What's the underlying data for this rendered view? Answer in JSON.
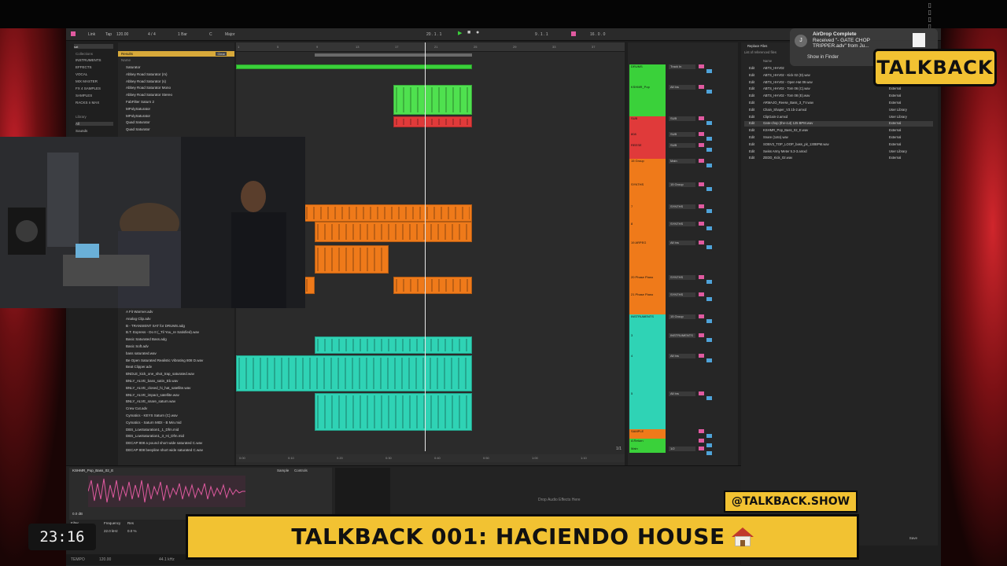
{
  "topbar": {
    "icons": [
      "wifi-icon",
      "battery-icon",
      "clock-icon"
    ]
  },
  "transport": {
    "link": "Link",
    "tap": "Tap",
    "tempo": "120.00",
    "signature": "4 / 4",
    "quantize": "1 Bar",
    "key": "C",
    "scale": "Major",
    "position": "20 . 1 . 1",
    "loop_start": "9 . 1 . 1",
    "loop_length": "16 . 0 . 0"
  },
  "browser": {
    "search_value": "sat",
    "collections_label": "Collections",
    "collections": [
      "INSTRUMENTS",
      "EFFECTS",
      "VOCAL",
      "MIX MASTER",
      "FX 4 SAMPLES",
      "SAMPLES",
      "RACKS n MAX"
    ],
    "library_label": "Library",
    "library": [
      "All",
      "Sounds"
    ],
    "results_label": "Results",
    "clear_label": "Clear",
    "name_header": "Name",
    "results_top": [
      "Saturator",
      "Abbey Road Saturator (m)",
      "Abbey Road Saturator (s)",
      "Abbey Road Saturator Mono",
      "Abbey Road Saturator Stereo",
      "FabFilter Saturn 2",
      "MPolySaturator",
      "MPolySaturator",
      "Quad Saturator",
      "Quad Saturator"
    ],
    "results_bottom": [
      "A Fit Warmer.adv",
      "Analog Clip.adv",
      "B - TRANSIENT SAT for DRUMS.adg",
      "B.T. Express - Do It (_Til You_re Satisfied).wav",
      "Basic Saturated Bass.adg",
      "Basic Soft.adv",
      "bass saturated.wav",
      "Be Open Saturated Realistic Vibrating 808 D.wav",
      "Beat Clipper.adv",
      "BNDLE_kick_one_shot_trap_saturated.wav",
      "BNLY_ALVE_bass_satin_Eb.wav",
      "BNLY_ALVE_closed_hi_hat_satellite.wav",
      "BNLY_ALVE_impact_satellite.wav",
      "BNLY_ALVE_snare_saturn.wav",
      "Crew Cut.adv",
      "Cymatics - KEYS Saturn (C).wav",
      "Cymatics - Saturn MIDI - B Min.mid",
      "DBS_LowSaturation1_1_Dfm.mid",
      "DBS_LowSaturation1_3_Hi_Dfm.mid",
      "DECAP 808 a pound short wide saturated C.wav",
      "DECAP 808 beepline short wide saturated C.wav"
    ]
  },
  "arrangement": {
    "ruler": [
      "1",
      "5",
      "9",
      "13",
      "17",
      "21",
      "25",
      "29",
      "33",
      "37"
    ],
    "time": [
      "0:00",
      "0:10",
      "0:20",
      "0:30",
      "0:40",
      "0:50",
      "1:00",
      "1:10"
    ],
    "page_indicator": "1/1"
  },
  "tracks": [
    {
      "name": "DRUMS",
      "color": "#3ad13a",
      "io": "Track In"
    },
    {
      "name": "KSHMR_Pop",
      "color": "#3ad13a",
      "io": "All Ins"
    },
    {
      "name": "SUB",
      "color": "#e03a3a",
      "io": "SUB"
    },
    {
      "name": "808",
      "color": "#e03a3a",
      "io": "SUB"
    },
    {
      "name": "REESE",
      "color": "#e03a3a",
      "io": "SUB"
    },
    {
      "name": "15 Group",
      "color": "#ef7a1a",
      "io": "Main"
    },
    {
      "name": "SYNTHS",
      "color": "#ef7a1a",
      "io": "15 Group"
    },
    {
      "name": "7",
      "color": "#ef7a1a",
      "io": "SYNTHS"
    },
    {
      "name": "8",
      "color": "#ef7a1a",
      "io": "SYNTHS"
    },
    {
      "name": "19 ARPEG",
      "color": "#ef7a1a",
      "io": "All Ins"
    },
    {
      "name": "20 Phase Piano",
      "color": "#ef7a1a",
      "io": "SYNTHS"
    },
    {
      "name": "21 Phase Piano",
      "color": "#ef7a1a",
      "io": "SYNTHS"
    },
    {
      "name": "INSTRUMENTS",
      "color": "#2fd3b5",
      "io": "15 Group"
    },
    {
      "name": "3",
      "color": "#2fd3b5",
      "io": "INSTRUMENTS"
    },
    {
      "name": "4",
      "color": "#2fd3b5",
      "io": "All Ins"
    },
    {
      "name": "5",
      "color": "#2fd3b5",
      "io": "All Ins"
    },
    {
      "name": "SAMPLE",
      "color": "#ef7a1a",
      "io": ""
    },
    {
      "name": "A Return",
      "color": "#3ad13a",
      "io": ""
    },
    {
      "name": "Main",
      "color": "#3ad13a",
      "io": "1/2"
    }
  ],
  "filelist": {
    "title": "Replace Files",
    "subtitle": "List of referenced files",
    "name_header": "Name",
    "edit_label": "Edit",
    "rows": [
      {
        "name": "ABTS_HHV02",
        "loc": "External"
      },
      {
        "name": "ABTS_HHV02 - Kick 02 (D).wav",
        "loc": "External"
      },
      {
        "name": "ABTS_HHV02 - Open Hat 09.wav",
        "loc": "External"
      },
      {
        "name": "ABTS_HHV02 - Tom 06 (C).wav",
        "loc": "External"
      },
      {
        "name": "ABTS_HHV02 - Tom 08 (E).wav",
        "loc": "External"
      },
      {
        "name": "ARMAJO_Reese_Bass_3_TV.wav",
        "loc": "External"
      },
      {
        "name": "Chain_Shaper_V3.1b-2.amxd",
        "loc": "User Library"
      },
      {
        "name": "ClipGain-2.amxd",
        "loc": "User Library"
      },
      {
        "name": "Gate-chop (the-cut) 125 BPM.wav",
        "loc": "External"
      },
      {
        "name": "KSHMR_Pop_Bass_02_E.wav",
        "loc": "External"
      },
      {
        "name": "Snare (1oto).wav",
        "loc": "External"
      },
      {
        "name": "SOBV3_TOP_LOOP_bass_pit_130BPM.wav",
        "loc": "External"
      },
      {
        "name": "Swiss Army Meter 5.3-3.amxd",
        "loc": "User Library"
      },
      {
        "name": "ZEDD_Kick_02.wav",
        "loc": "External"
      }
    ],
    "save_label": "Save"
  },
  "detail": {
    "clip_name": "KSHMR_Pop_Bass_02_E",
    "sample_tab": "Sample",
    "controls_tab": "Controls",
    "gain": "0.0 dB",
    "filter_label": "Filter",
    "frequency_label": "Frequency",
    "res_label": "Res",
    "freq_value": "22.0 kHz",
    "res_value": "0.0 %",
    "drop_text": "Drop Audio Effects Here",
    "status_tempo": "120.00",
    "status_rate": "44.1 kHz",
    "status_label": "TEMPO"
  },
  "airdrop": {
    "title": "AirDrop Complete",
    "message": "Received \"- GATE CHOP TRIPPER.adv\" from Ju...",
    "action": "Show in Finder",
    "icon": "airdrop-icon"
  },
  "overlay": {
    "logo": "TALKBACK",
    "handle": "@TALKBACK.SHOW",
    "banner": "TALKBACK 001: HACIENDO HOUSE",
    "house_icon": "house-icon",
    "timer": "23:16",
    "colors": {
      "accent": "#f2c232",
      "outline": "#0b0b0b"
    }
  }
}
